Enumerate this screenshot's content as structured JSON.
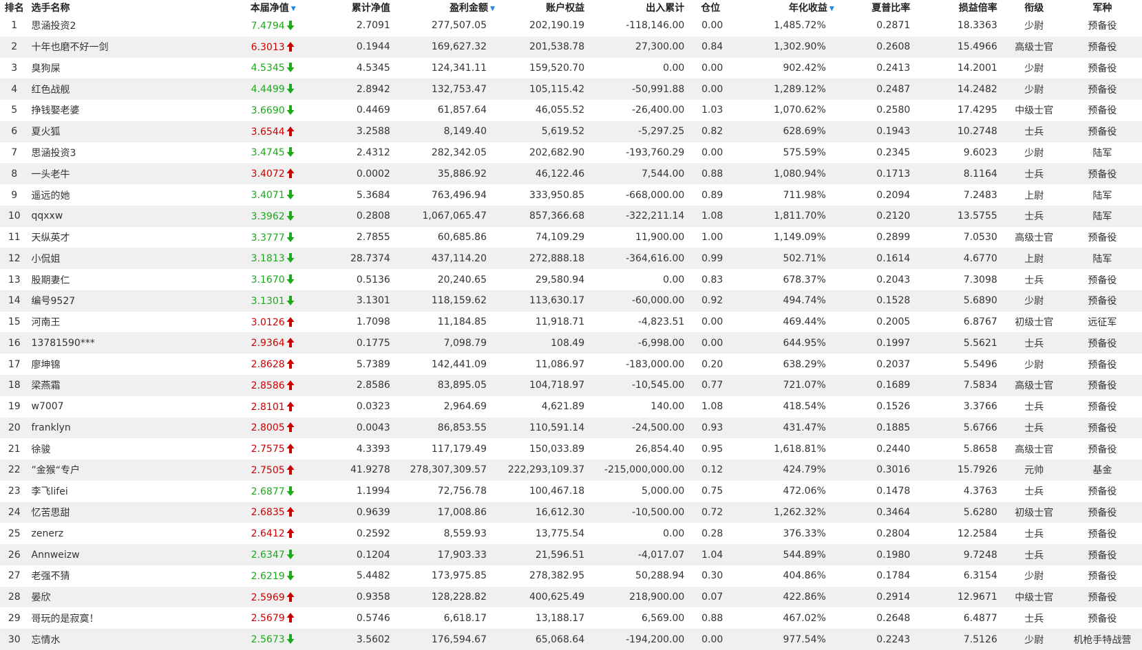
{
  "colors": {
    "up": "#cc0000",
    "down": "#1aaa1a",
    "sort_indicator": "#1e88e5",
    "row_alt_bg": "#f0f0f0"
  },
  "columns": [
    {
      "label": "排名",
      "sort": ""
    },
    {
      "label": "选手名称",
      "sort": ""
    },
    {
      "label": "本届净值",
      "sort": "▼"
    },
    {
      "label": "累计净值",
      "sort": ""
    },
    {
      "label": "盈利金额",
      "sort": "▼"
    },
    {
      "label": "账户权益",
      "sort": ""
    },
    {
      "label": "出入累计",
      "sort": ""
    },
    {
      "label": "仓位",
      "sort": ""
    },
    {
      "label": "年化收益",
      "sort": "▼"
    },
    {
      "label": "夏普比率",
      "sort": ""
    },
    {
      "label": "损益倍率",
      "sort": ""
    },
    {
      "label": "衔级",
      "sort": ""
    },
    {
      "label": "军种",
      "sort": ""
    }
  ],
  "rows": [
    {
      "rank": "1",
      "name": "思涵投资2",
      "nav": "7.4794",
      "trend": "down",
      "cum_nav": "2.7091",
      "profit": "277,507.05",
      "equity": "202,190.19",
      "flow": "-118,146.00",
      "position": "0.00",
      "annual": "1,485.72%",
      "sharpe": "0.2871",
      "ratio": "18.3363",
      "rank_title": "少尉",
      "branch": "预备役"
    },
    {
      "rank": "2",
      "name": "十年也磨不好一剑",
      "nav": "6.3013",
      "trend": "up",
      "cum_nav": "0.1944",
      "profit": "169,627.32",
      "equity": "201,538.78",
      "flow": "27,300.00",
      "position": "0.84",
      "annual": "1,302.90%",
      "sharpe": "0.2608",
      "ratio": "15.4966",
      "rank_title": "高级士官",
      "branch": "预备役"
    },
    {
      "rank": "3",
      "name": "臭狗屎",
      "nav": "4.5345",
      "trend": "down",
      "cum_nav": "4.5345",
      "profit": "124,341.11",
      "equity": "159,520.70",
      "flow": "0.00",
      "position": "0.00",
      "annual": "902.42%",
      "sharpe": "0.2413",
      "ratio": "14.2001",
      "rank_title": "少尉",
      "branch": "预备役"
    },
    {
      "rank": "4",
      "name": "红色战舰",
      "nav": "4.4499",
      "trend": "down",
      "cum_nav": "2.8942",
      "profit": "132,753.47",
      "equity": "105,115.42",
      "flow": "-50,991.88",
      "position": "0.00",
      "annual": "1,289.12%",
      "sharpe": "0.2487",
      "ratio": "14.2482",
      "rank_title": "少尉",
      "branch": "预备役"
    },
    {
      "rank": "5",
      "name": "挣钱娶老婆",
      "nav": "3.6690",
      "trend": "down",
      "cum_nav": "0.4469",
      "profit": "61,857.64",
      "equity": "46,055.52",
      "flow": "-26,400.00",
      "position": "1.03",
      "annual": "1,070.62%",
      "sharpe": "0.2580",
      "ratio": "17.4295",
      "rank_title": "中级士官",
      "branch": "预备役"
    },
    {
      "rank": "6",
      "name": "夏火狐",
      "nav": "3.6544",
      "trend": "up",
      "cum_nav": "3.2588",
      "profit": "8,149.40",
      "equity": "5,619.52",
      "flow": "-5,297.25",
      "position": "0.82",
      "annual": "628.69%",
      "sharpe": "0.1943",
      "ratio": "10.2748",
      "rank_title": "士兵",
      "branch": "预备役"
    },
    {
      "rank": "7",
      "name": "思涵投资3",
      "nav": "3.4745",
      "trend": "down",
      "cum_nav": "2.4312",
      "profit": "282,342.05",
      "equity": "202,682.90",
      "flow": "-193,760.29",
      "position": "0.00",
      "annual": "575.59%",
      "sharpe": "0.2345",
      "ratio": "9.6023",
      "rank_title": "少尉",
      "branch": "陆军"
    },
    {
      "rank": "8",
      "name": "一头老牛",
      "nav": "3.4072",
      "trend": "up",
      "cum_nav": "0.0002",
      "profit": "35,886.92",
      "equity": "46,122.46",
      "flow": "7,544.00",
      "position": "0.88",
      "annual": "1,080.94%",
      "sharpe": "0.1713",
      "ratio": "8.1164",
      "rank_title": "士兵",
      "branch": "预备役"
    },
    {
      "rank": "9",
      "name": "遥远的她",
      "nav": "3.4071",
      "trend": "down",
      "cum_nav": "5.3684",
      "profit": "763,496.94",
      "equity": "333,950.85",
      "flow": "-668,000.00",
      "position": "0.89",
      "annual": "711.98%",
      "sharpe": "0.2094",
      "ratio": "7.2483",
      "rank_title": "上尉",
      "branch": "陆军"
    },
    {
      "rank": "10",
      "name": "qqxxw",
      "nav": "3.3962",
      "trend": "down",
      "cum_nav": "0.2808",
      "profit": "1,067,065.47",
      "equity": "857,366.68",
      "flow": "-322,211.14",
      "position": "1.08",
      "annual": "1,811.70%",
      "sharpe": "0.2120",
      "ratio": "13.5755",
      "rank_title": "士兵",
      "branch": "陆军"
    },
    {
      "rank": "11",
      "name": "天纵英才",
      "nav": "3.3777",
      "trend": "down",
      "cum_nav": "2.7855",
      "profit": "60,685.86",
      "equity": "74,109.29",
      "flow": "11,900.00",
      "position": "1.00",
      "annual": "1,149.09%",
      "sharpe": "0.2899",
      "ratio": "7.0530",
      "rank_title": "高级士官",
      "branch": "预备役"
    },
    {
      "rank": "12",
      "name": "小侃姐",
      "nav": "3.1813",
      "trend": "down",
      "cum_nav": "28.7374",
      "profit": "437,114.20",
      "equity": "272,888.18",
      "flow": "-364,616.00",
      "position": "0.99",
      "annual": "502.71%",
      "sharpe": "0.1614",
      "ratio": "4.6770",
      "rank_title": "上尉",
      "branch": "陆军"
    },
    {
      "rank": "13",
      "name": "股期妻仁",
      "nav": "3.1670",
      "trend": "down",
      "cum_nav": "0.5136",
      "profit": "20,240.65",
      "equity": "29,580.94",
      "flow": "0.00",
      "position": "0.83",
      "annual": "678.37%",
      "sharpe": "0.2043",
      "ratio": "7.3098",
      "rank_title": "士兵",
      "branch": "预备役"
    },
    {
      "rank": "14",
      "name": "编号9527",
      "nav": "3.1301",
      "trend": "down",
      "cum_nav": "3.1301",
      "profit": "118,159.62",
      "equity": "113,630.17",
      "flow": "-60,000.00",
      "position": "0.92",
      "annual": "494.74%",
      "sharpe": "0.1528",
      "ratio": "5.6890",
      "rank_title": "少尉",
      "branch": "预备役"
    },
    {
      "rank": "15",
      "name": "河南王",
      "nav": "3.0126",
      "trend": "up",
      "cum_nav": "1.7098",
      "profit": "11,184.85",
      "equity": "11,918.71",
      "flow": "-4,823.51",
      "position": "0.00",
      "annual": "469.44%",
      "sharpe": "0.2005",
      "ratio": "6.8767",
      "rank_title": "初级士官",
      "branch": "远征军"
    },
    {
      "rank": "16",
      "name": "13781590***",
      "nav": "2.9364",
      "trend": "up",
      "cum_nav": "0.1775",
      "profit": "7,098.79",
      "equity": "108.49",
      "flow": "-6,998.00",
      "position": "0.00",
      "annual": "644.95%",
      "sharpe": "0.1997",
      "ratio": "5.5621",
      "rank_title": "士兵",
      "branch": "预备役"
    },
    {
      "rank": "17",
      "name": "廖坤锦",
      "nav": "2.8628",
      "trend": "up",
      "cum_nav": "5.7389",
      "profit": "142,441.09",
      "equity": "11,086.97",
      "flow": "-183,000.00",
      "position": "0.20",
      "annual": "638.29%",
      "sharpe": "0.2037",
      "ratio": "5.5496",
      "rank_title": "少尉",
      "branch": "预备役"
    },
    {
      "rank": "18",
      "name": "梁燕霜",
      "nav": "2.8586",
      "trend": "up",
      "cum_nav": "2.8586",
      "profit": "83,895.05",
      "equity": "104,718.97",
      "flow": "-10,545.00",
      "position": "0.77",
      "annual": "721.07%",
      "sharpe": "0.1689",
      "ratio": "7.5834",
      "rank_title": "高级士官",
      "branch": "预备役"
    },
    {
      "rank": "19",
      "name": "w7007",
      "nav": "2.8101",
      "trend": "up",
      "cum_nav": "0.0323",
      "profit": "2,964.69",
      "equity": "4,621.89",
      "flow": "140.00",
      "position": "1.08",
      "annual": "418.54%",
      "sharpe": "0.1526",
      "ratio": "3.3766",
      "rank_title": "士兵",
      "branch": "预备役"
    },
    {
      "rank": "20",
      "name": "franklyn",
      "nav": "2.8005",
      "trend": "up",
      "cum_nav": "0.0043",
      "profit": "86,853.55",
      "equity": "110,591.14",
      "flow": "-24,500.00",
      "position": "0.93",
      "annual": "431.47%",
      "sharpe": "0.1885",
      "ratio": "5.6766",
      "rank_title": "士兵",
      "branch": "预备役"
    },
    {
      "rank": "21",
      "name": "徐骏",
      "nav": "2.7575",
      "trend": "up",
      "cum_nav": "4.3393",
      "profit": "117,179.49",
      "equity": "150,033.89",
      "flow": "26,854.40",
      "position": "0.95",
      "annual": "1,618.81%",
      "sharpe": "0.2440",
      "ratio": "5.8658",
      "rank_title": "高级士官",
      "branch": "预备役"
    },
    {
      "rank": "22",
      "name": "”金猴“专户",
      "nav": "2.7505",
      "trend": "up",
      "cum_nav": "41.9278",
      "profit": "278,307,309.57",
      "equity": "222,293,109.37",
      "flow": "-215,000,000.00",
      "position": "0.12",
      "annual": "424.79%",
      "sharpe": "0.3016",
      "ratio": "15.7926",
      "rank_title": "元帅",
      "branch": "基金"
    },
    {
      "rank": "23",
      "name": "李飞lifei",
      "nav": "2.6877",
      "trend": "down",
      "cum_nav": "1.1994",
      "profit": "72,756.78",
      "equity": "100,467.18",
      "flow": "5,000.00",
      "position": "0.75",
      "annual": "472.06%",
      "sharpe": "0.1478",
      "ratio": "4.3763",
      "rank_title": "士兵",
      "branch": "预备役"
    },
    {
      "rank": "24",
      "name": "忆苦思甜",
      "nav": "2.6835",
      "trend": "up",
      "cum_nav": "0.9639",
      "profit": "17,008.86",
      "equity": "16,612.30",
      "flow": "-10,500.00",
      "position": "0.72",
      "annual": "1,262.32%",
      "sharpe": "0.3464",
      "ratio": "5.6280",
      "rank_title": "初级士官",
      "branch": "预备役"
    },
    {
      "rank": "25",
      "name": "zenerz",
      "nav": "2.6412",
      "trend": "up",
      "cum_nav": "0.2592",
      "profit": "8,559.93",
      "equity": "13,775.54",
      "flow": "0.00",
      "position": "0.28",
      "annual": "376.33%",
      "sharpe": "0.2804",
      "ratio": "12.2584",
      "rank_title": "士兵",
      "branch": "预备役"
    },
    {
      "rank": "26",
      "name": "Annweizw",
      "nav": "2.6347",
      "trend": "down",
      "cum_nav": "0.1204",
      "profit": "17,903.33",
      "equity": "21,596.51",
      "flow": "-4,017.07",
      "position": "1.04",
      "annual": "544.89%",
      "sharpe": "0.1980",
      "ratio": "9.7248",
      "rank_title": "士兵",
      "branch": "预备役"
    },
    {
      "rank": "27",
      "name": "老强不猜",
      "nav": "2.6219",
      "trend": "down",
      "cum_nav": "5.4482",
      "profit": "173,975.85",
      "equity": "278,382.95",
      "flow": "50,288.94",
      "position": "0.30",
      "annual": "404.86%",
      "sharpe": "0.1784",
      "ratio": "6.3154",
      "rank_title": "少尉",
      "branch": "预备役"
    },
    {
      "rank": "28",
      "name": "晏欣",
      "nav": "2.5969",
      "trend": "up",
      "cum_nav": "0.9358",
      "profit": "128,228.82",
      "equity": "400,625.49",
      "flow": "218,900.00",
      "position": "0.07",
      "annual": "422.86%",
      "sharpe": "0.2914",
      "ratio": "12.9671",
      "rank_title": "中级士官",
      "branch": "预备役"
    },
    {
      "rank": "29",
      "name": "哥玩的是寂寞！",
      "nav": "2.5679",
      "trend": "up",
      "cum_nav": "0.5746",
      "profit": "6,618.17",
      "equity": "13,188.17",
      "flow": "6,569.00",
      "position": "0.88",
      "annual": "467.02%",
      "sharpe": "0.2648",
      "ratio": "6.4877",
      "rank_title": "士兵",
      "branch": "预备役"
    },
    {
      "rank": "30",
      "name": "忘情水",
      "nav": "2.5673",
      "trend": "down",
      "cum_nav": "3.5602",
      "profit": "176,594.67",
      "equity": "65,068.64",
      "flow": "-194,200.00",
      "position": "0.00",
      "annual": "977.54%",
      "sharpe": "0.2243",
      "ratio": "7.5126",
      "rank_title": "少尉",
      "branch": "机枪手特战营"
    }
  ]
}
